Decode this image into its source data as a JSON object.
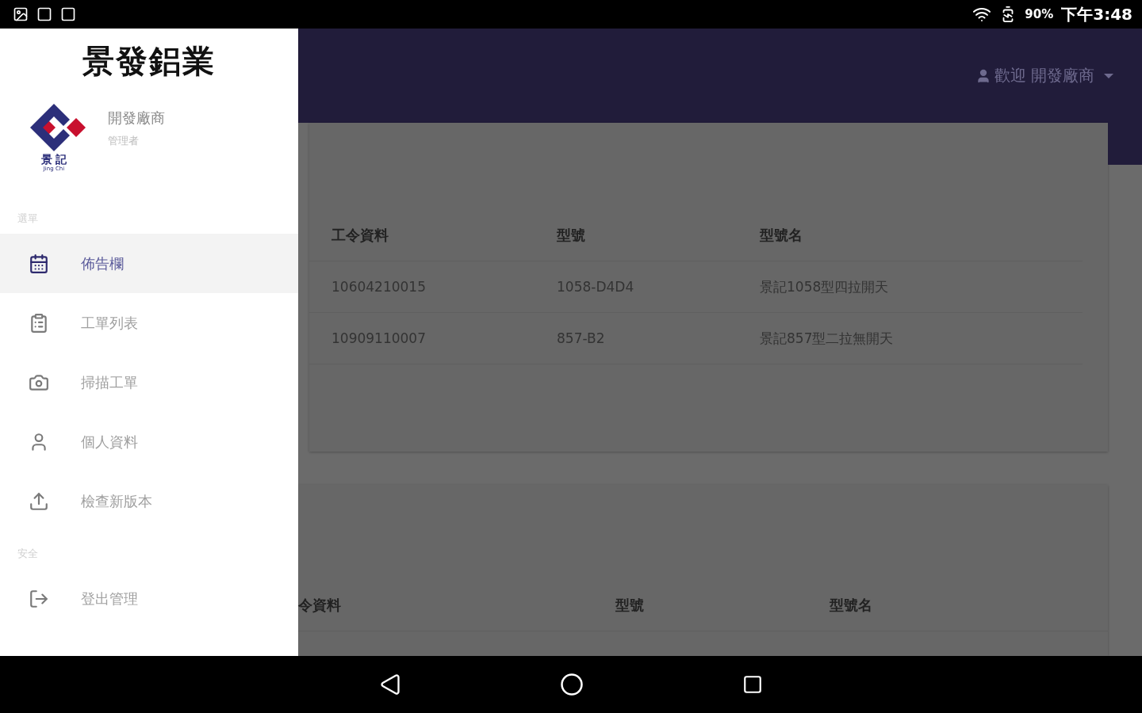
{
  "status_bar": {
    "battery": "90%",
    "time": "下午3:48"
  },
  "drawer": {
    "title": "景發鋁業",
    "logo": {
      "text": "景 記",
      "subtext": "Jing Chi"
    },
    "user": {
      "name": "開發廠商",
      "role": "管理者"
    },
    "sections": [
      {
        "label": "選單",
        "items": [
          {
            "kind": "calendar",
            "label": "佈告欄",
            "selected": true
          },
          {
            "kind": "clipboard",
            "label": "工單列表",
            "selected": false
          },
          {
            "kind": "camera",
            "label": "掃描工單",
            "selected": false
          },
          {
            "kind": "person",
            "label": "個人資料",
            "selected": false
          },
          {
            "kind": "upload",
            "label": "檢查新版本",
            "selected": false
          }
        ]
      },
      {
        "label": "安全",
        "items": [
          {
            "kind": "logout",
            "label": "登出管理",
            "selected": false
          }
        ]
      }
    ]
  },
  "header": {
    "user_menu": "歡迎 開發廠商"
  },
  "tables": [
    {
      "columns": [
        "工令資料",
        "型號",
        "型號名"
      ],
      "rows": [
        [
          "10604210015",
          "1058-D4D4",
          "景記1058型四拉開天"
        ],
        [
          "10909110007",
          "857-B2",
          "景記857型二拉無開天"
        ]
      ]
    },
    {
      "columns": [
        "令資料",
        "型號",
        "型號名"
      ]
    }
  ]
}
